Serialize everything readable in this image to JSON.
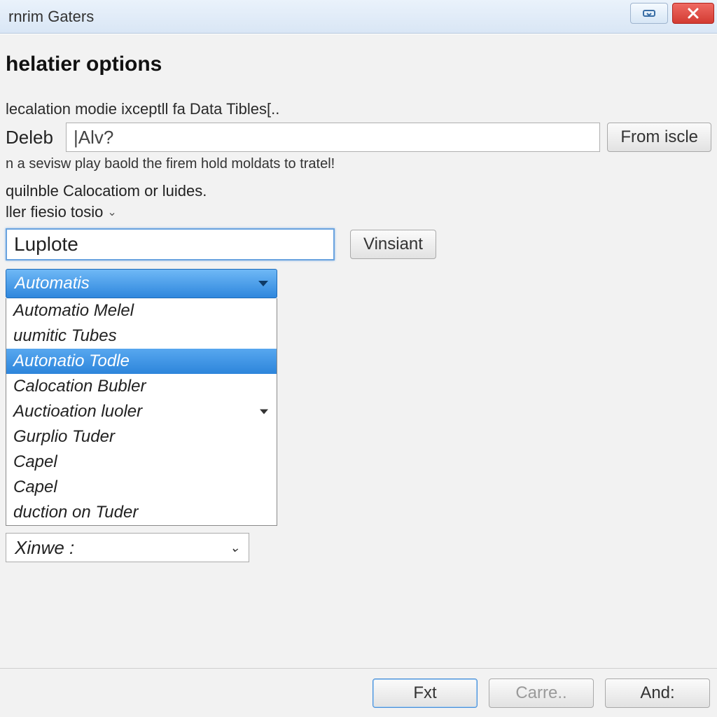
{
  "window": {
    "title": "rnrim Gaters"
  },
  "heading": "helatier options",
  "mode_line": "lecalation modie ixceptll fa Data Tibles[..",
  "field1": {
    "label": "Deleb",
    "value": "|Alv?",
    "button": "From iscle"
  },
  "hint": "n a sevisw play baold the firem hold moldats to tratel!",
  "section": "quilnble Calocatiom or luides.",
  "inline_dropdown": "ller fiesio tosio",
  "wide_input": {
    "value": "Luplote",
    "button": "Vinsiant"
  },
  "combo": {
    "selected": "Automatis",
    "highlighted_index": 2,
    "options": [
      "Automatio Melel",
      "uumitic Tubes",
      "Autonatio Todle",
      "Calocation Bubler",
      "Auctioation luoler",
      "Gurplio Tuder",
      "Capel",
      "Capel",
      "duction on Tuder"
    ],
    "submenu_index": 4
  },
  "bottom_combo": "Xinwe :",
  "footer": {
    "primary": "Fxt",
    "cancel": "Carre..",
    "and": "And:"
  }
}
